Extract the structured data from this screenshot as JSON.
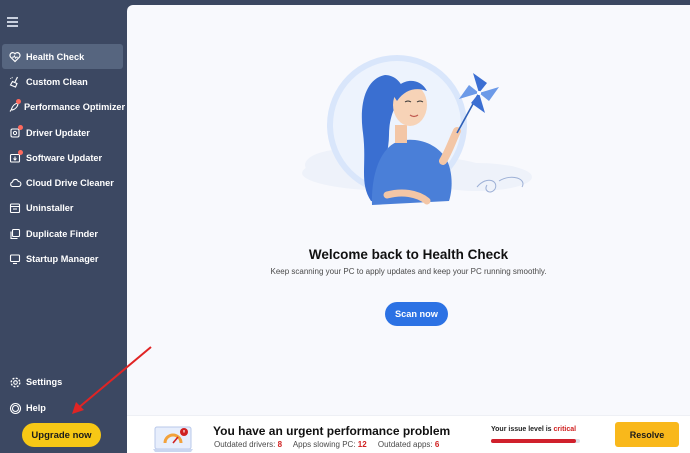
{
  "sidebar": {
    "items": [
      {
        "label": "Health Check",
        "icon": "heart-icon",
        "active": true
      },
      {
        "label": "Custom Clean",
        "icon": "broom-icon"
      },
      {
        "label": "Performance Optimizer",
        "icon": "rocket-icon",
        "alert": true
      },
      {
        "label": "Driver Updater",
        "icon": "chip-icon",
        "alert": true
      },
      {
        "label": "Software Updater",
        "icon": "box-icon",
        "alert": true
      },
      {
        "label": "Cloud Drive Cleaner",
        "icon": "cloud-icon"
      },
      {
        "label": "Uninstaller",
        "icon": "trash-icon"
      },
      {
        "label": "Duplicate Finder",
        "icon": "copy-icon"
      },
      {
        "label": "Startup Manager",
        "icon": "monitor-icon"
      }
    ],
    "settings_label": "Settings",
    "help_label": "Help",
    "upgrade_label": "Upgrade now"
  },
  "main": {
    "title": "Welcome back to Health Check",
    "subtitle": "Keep scanning your PC to apply updates and keep your PC running smoothly.",
    "scan_label": "Scan now"
  },
  "status_bar": {
    "title": "You have an urgent performance problem",
    "stats": [
      {
        "label": "Outdated drivers:",
        "value": "8"
      },
      {
        "label": "Apps slowing PC:",
        "value": "12"
      },
      {
        "label": "Outdated apps:",
        "value": "6"
      }
    ],
    "issue_prefix": "Your issue level is",
    "issue_level": "critical",
    "issue_level_fraction": 0.95,
    "resolve_label": "Resolve"
  },
  "colors": {
    "sidebar_bg": "#3c4862",
    "accent_blue": "#2c72e4",
    "upgrade_yellow": "#f7c815",
    "resolve_yellow": "#f9b81b",
    "critical_red": "#d02020"
  }
}
